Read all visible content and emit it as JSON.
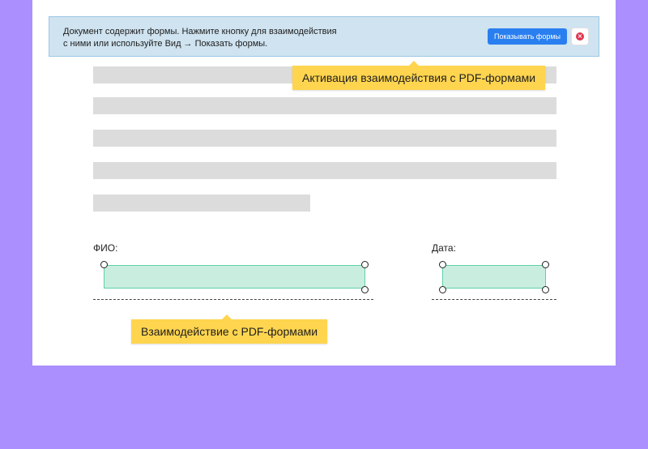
{
  "infobar": {
    "message_line1": "Документ содержит формы. Нажмите кнопку для взаимодействия",
    "message_line2": "с ними или используйте Вид → Показать формы.",
    "show_forms_label": "Показывать формы",
    "close_icon": "close-icon",
    "close_color": "#e0344f",
    "accent_color": "#2a7ff0"
  },
  "callouts": {
    "activation": "Активация взаимодействия с PDF-формами",
    "interaction": "Взаимодействие с PDF-формами"
  },
  "form": {
    "name_label": "ФИО:",
    "date_label": "Дата:",
    "field_color": "#c9eee0"
  },
  "colors": {
    "background": "#ab8ffe",
    "callout": "#ffd54f"
  }
}
